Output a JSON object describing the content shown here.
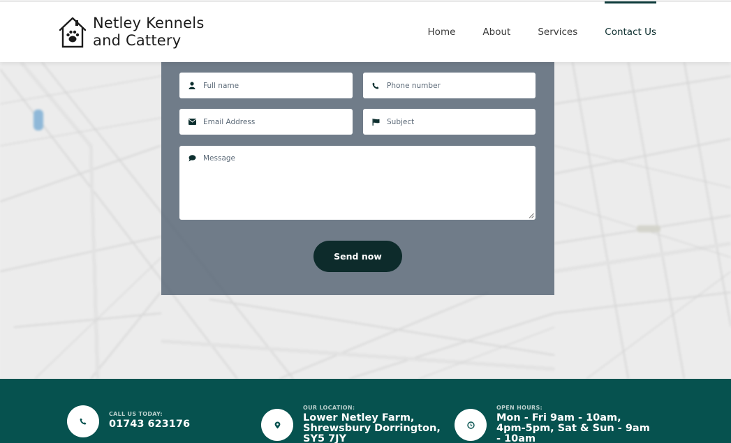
{
  "brand": {
    "name_line1": "Netley Kennels",
    "name_line2": "and Cattery",
    "logo_icon": "house-paw-icon"
  },
  "nav": {
    "items": [
      {
        "label": "Home",
        "active": false
      },
      {
        "label": "About",
        "active": false
      },
      {
        "label": "Services",
        "active": false
      },
      {
        "label": "Contact Us",
        "active": true
      }
    ]
  },
  "form": {
    "full_name_placeholder": "Full name",
    "phone_placeholder": "Phone number",
    "email_placeholder": "Email Address",
    "subject_placeholder": "Subject",
    "message_placeholder": "Message",
    "send_label": "Send now"
  },
  "footer": {
    "call": {
      "label": "CALL US TODAY:",
      "value": "01743 623176",
      "icon": "phone-icon"
    },
    "location": {
      "label": "OUR LOCATION:",
      "value": "Lower Netley Farm, Shrewsbury Dorrington, SY5 7JY",
      "icon": "map-pin-icon"
    },
    "hours": {
      "label": "OPEN HOURS:",
      "value": "Mon - Fri 9am - 10am, 4pm-5pm, Sat & Sun - 9am - 10am",
      "icon": "clock-icon"
    }
  },
  "colors": {
    "accent": "#0d2b2b",
    "footer_bg": "#06524f",
    "panel_bg": "#546373"
  }
}
